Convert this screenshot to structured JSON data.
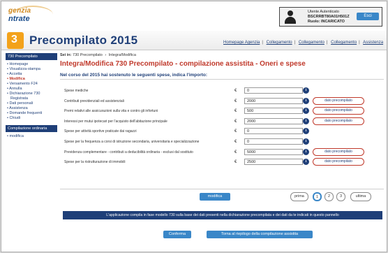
{
  "header": {
    "logo_top": "genzia",
    "logo_bottom": "ntrate",
    "user_label": "Utente Autenticato",
    "user_code": "BSCRRBT80A01H501Z",
    "user_role": "Ruolo: INCARICATO",
    "logout_label": "Esci"
  },
  "title_band": {
    "badge_number": "3",
    "app_title": "Precompilato 2015",
    "links": [
      "Homepage Agenzia",
      "Collegamento",
      "Collegamento",
      "Collegamento",
      "Assistenza"
    ]
  },
  "sidebar": {
    "section1_title": "730 Precompilato",
    "items": [
      {
        "label": "• Homepage",
        "sub": false,
        "active": false
      },
      {
        "label": "• Visualizza-stampa",
        "sub": false,
        "active": false
      },
      {
        "label": "• Accetta",
        "sub": false,
        "active": false
      },
      {
        "label": "• Modifica",
        "sub": false,
        "active": true
      },
      {
        "label": "• Versamento F24",
        "sub": false,
        "active": false
      },
      {
        "label": "• Annulla",
        "sub": false,
        "active": false
      },
      {
        "label": "• Dichiarazione 730",
        "sub": false,
        "active": false
      },
      {
        "label": "Registrata",
        "sub": true,
        "active": false
      },
      {
        "label": "• Dati personali",
        "sub": false,
        "active": false
      },
      {
        "label": "• Assistenza",
        "sub": false,
        "active": false
      },
      {
        "label": "• Domande frequenti",
        "sub": false,
        "active": false
      },
      {
        "label": "• Chiudi",
        "sub": false,
        "active": false
      }
    ],
    "section2_title": "Compilazione ordinaria",
    "items2": [
      {
        "label": "• modifica"
      }
    ]
  },
  "main": {
    "breadcrumb": [
      "Sei in:",
      "730 Precompilato",
      "Integra/Modifica"
    ],
    "page_title": "Integra/Modifica 730 Precompilato - compilazione assistita - Oneri e spese",
    "question": "Nel corso del 2015 hai sostenuto le seguenti spese, indica l'importo:",
    "currency_symbol": "€",
    "info_symbol": "i",
    "rows": [
      {
        "label": "Spese mediche",
        "value": "0",
        "button": ""
      },
      {
        "label": "Contributi previdenziali ed assistenziali",
        "value": "2000",
        "button": "dato precompilato"
      },
      {
        "label": "Premi relativi alle assicurazioni sulla vita e contro gli infortuni",
        "value": "500",
        "button": "dato precompilato"
      },
      {
        "label": "Interessi per mutui ipotecari per l'acquisto dell'abitazione principale",
        "value": "2000",
        "button": "dato precompilato"
      },
      {
        "label": "Spese per attività sportive praticate dai ragazzi",
        "value": "0",
        "button": ""
      },
      {
        "label": "Spese per la frequenza a corsi di istruzione secondaria, universitaria e specializzazione",
        "value": "0",
        "button": ""
      },
      {
        "label": "Previdenza complementare - contributi a deducibilità ordinaria - esclusi dal sostituto",
        "value": "5000",
        "button": "dato precompilato"
      },
      {
        "label": "Spese per la ristrutturazione di immobili",
        "value": "2500",
        "button": "dato precompilato"
      }
    ],
    "modify_label": "modifica",
    "pager": {
      "first": "prima",
      "pages": [
        "1",
        "2",
        "3"
      ],
      "current": "1",
      "last": "ultima"
    },
    "info_text": "L'applicazione compila in fase modello 730 sulla base dei dati presenti nella dichiarazione precompilata e dei dati da te indicati in questo pannello"
  },
  "footer": {
    "confirm_label": "Conferma",
    "back_label": "Torna al riepilogo della compilazione assistita"
  },
  "colors": {
    "brand_blue": "#1f3f78",
    "accent_red": "#c0392b",
    "button_blue": "#3a87c8",
    "badge_orange": "#f3a21a"
  }
}
